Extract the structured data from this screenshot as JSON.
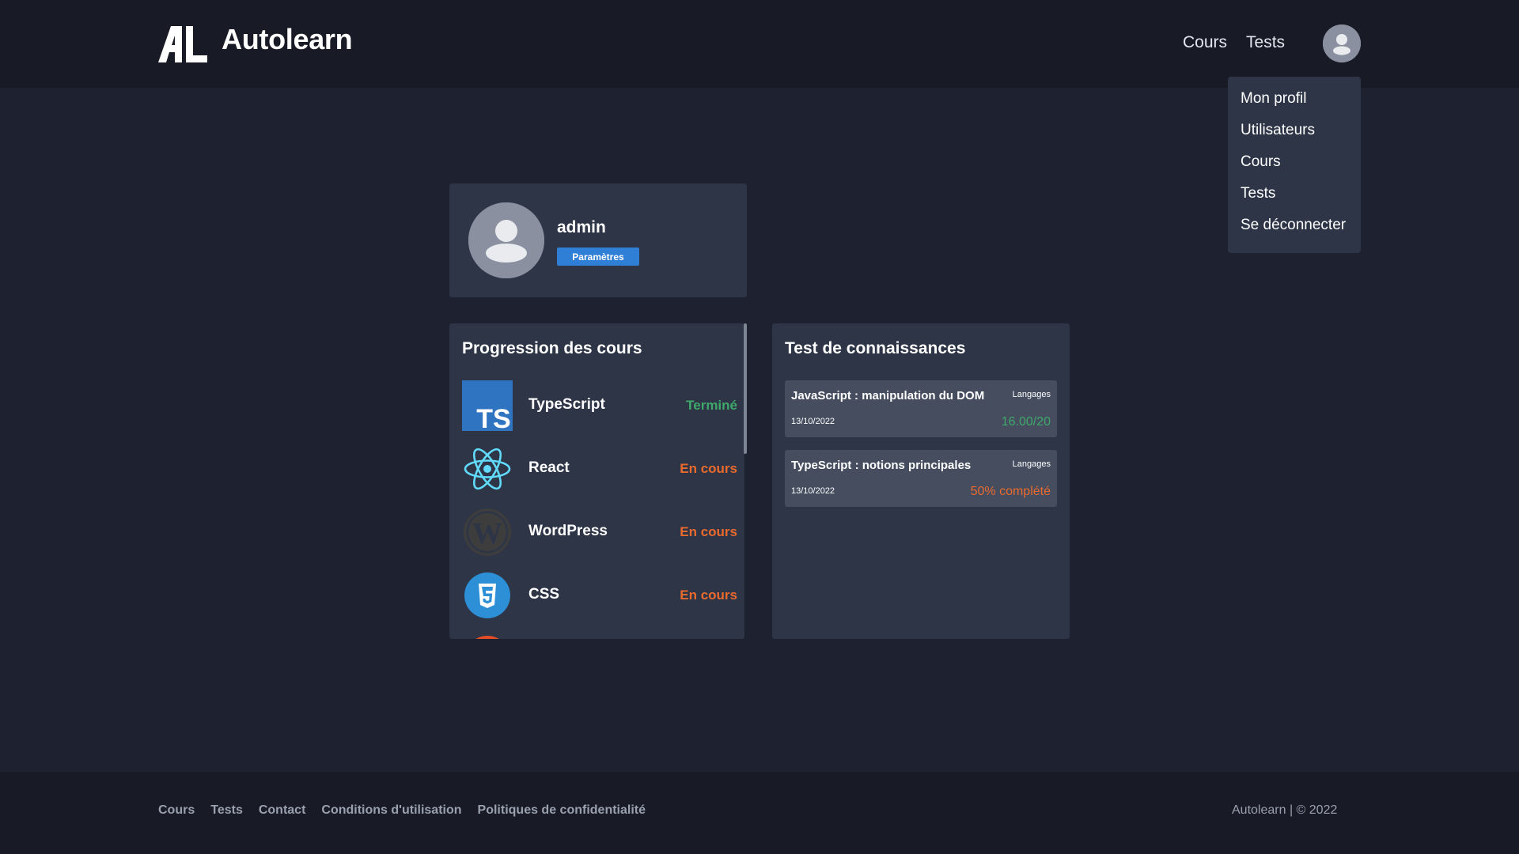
{
  "brand": {
    "name": "Autolearn",
    "logo_mark": "AL"
  },
  "header": {
    "nav": [
      {
        "label": "Cours"
      },
      {
        "label": "Tests"
      }
    ],
    "avatar_icon": "user-icon"
  },
  "user_menu": {
    "items": [
      {
        "label": "Mon profil"
      },
      {
        "label": "Utilisateurs"
      },
      {
        "label": "Cours"
      },
      {
        "label": "Tests"
      },
      {
        "label": "Se déconnecter"
      }
    ]
  },
  "profile": {
    "username": "admin",
    "settings_label": "Paramètres"
  },
  "course_progress": {
    "title": "Progression des cours",
    "courses": [
      {
        "name": "TypeScript",
        "status": "Terminé",
        "icon": "typescript-icon",
        "icon_text": "TS"
      },
      {
        "name": "React",
        "status": "En cours",
        "icon": "react-icon"
      },
      {
        "name": "WordPress",
        "status": "En cours",
        "icon": "wordpress-icon"
      },
      {
        "name": "CSS",
        "status": "En cours",
        "icon": "css-icon"
      }
    ]
  },
  "knowledge_tests": {
    "title": "Test de connaissances",
    "tests": [
      {
        "title": "JavaScript : manipulation du DOM",
        "tag": "Langages",
        "date": "13/10/2022",
        "result": "16.00/20"
      },
      {
        "title": "TypeScript : notions principales",
        "tag": "Langages",
        "date": "13/10/2022",
        "result": "50% complété"
      }
    ]
  },
  "footer": {
    "links": [
      {
        "label": "Cours"
      },
      {
        "label": "Tests"
      },
      {
        "label": "Contact"
      },
      {
        "label": "Conditions d'utilisation"
      },
      {
        "label": "Politiques de confidentialité"
      }
    ],
    "copyright": "Autolearn | © 2022"
  },
  "colors": {
    "page_bg": "#1e2230",
    "header_bg": "#181b26",
    "card_bg": "#2d3547",
    "accent_blue": "#2f7fd6",
    "status_done": "#3fa86a",
    "status_in_progress": "#ea6a2e"
  }
}
